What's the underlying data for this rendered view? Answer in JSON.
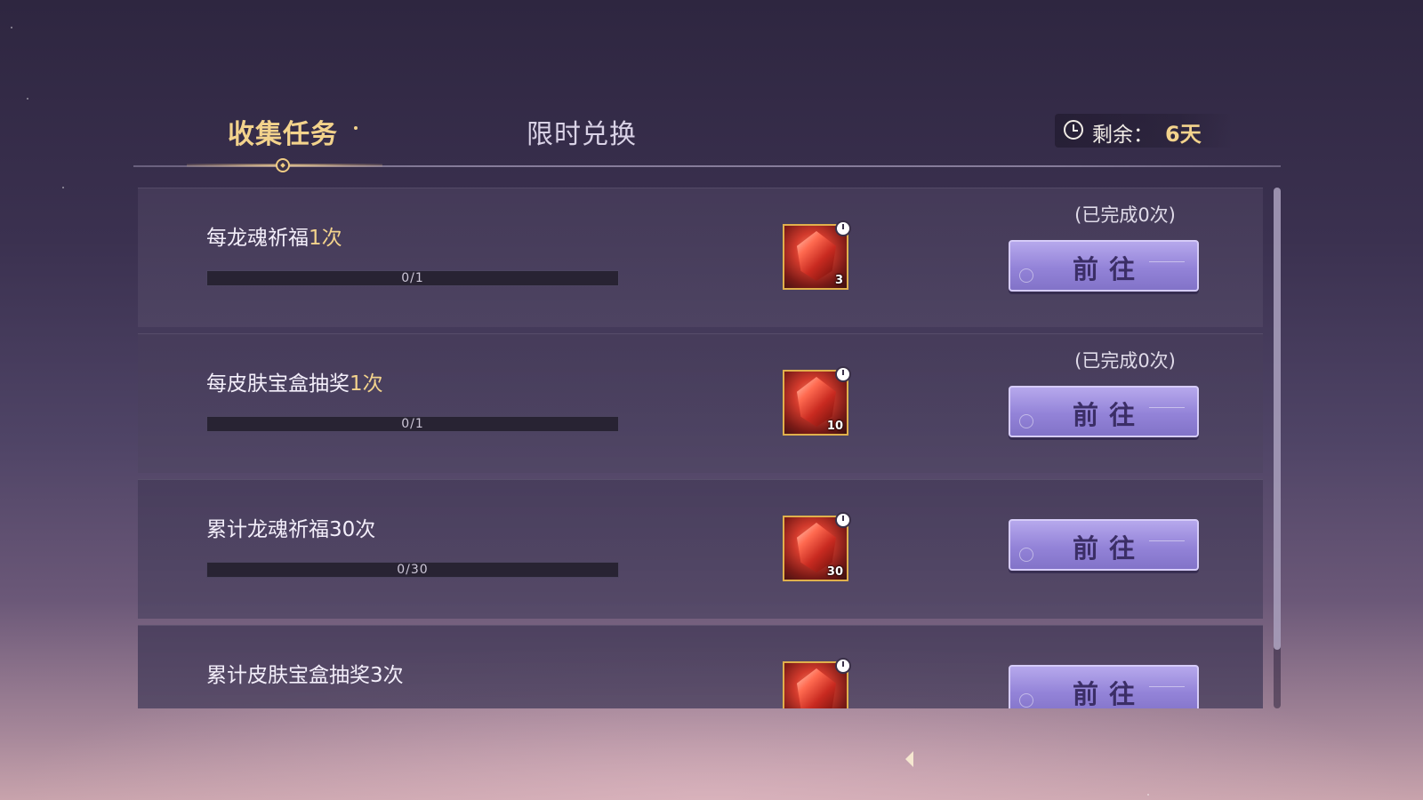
{
  "tabs": [
    {
      "label": "收集任务",
      "active": true
    },
    {
      "label": "限时兑换",
      "active": false
    }
  ],
  "timer": {
    "label": "剩余：",
    "value": "6天",
    "icon": "clock-icon"
  },
  "tasks": [
    {
      "title_main": "每龙魂祈福",
      "title_highlight": "1次",
      "progress_text": "0/1",
      "progress": 0,
      "reward_icon": "red-crystal-icon",
      "reward_count": "3",
      "completed_text": "(已完成0次)",
      "button_label": "前往"
    },
    {
      "title_main": "每皮肤宝盒抽奖",
      "title_highlight": "1次",
      "progress_text": "0/1",
      "progress": 0,
      "reward_icon": "red-crystal-icon",
      "reward_count": "10",
      "completed_text": "(已完成0次)",
      "button_label": "前往"
    },
    {
      "title_main": "累计龙魂祈福30次",
      "title_highlight": "",
      "progress_text": "0/30",
      "progress": 0,
      "reward_icon": "red-crystal-icon",
      "reward_count": "30",
      "completed_text": "",
      "button_label": "前往"
    },
    {
      "title_main": "累计皮肤宝盒抽奖3次",
      "title_highlight": "",
      "progress_text": "",
      "progress": 0,
      "reward_icon": "red-crystal-icon",
      "reward_count": "",
      "completed_text": "",
      "button_label": "前往"
    }
  ],
  "colors": {
    "accent_gold": "#f3d38c",
    "button": "#9383d8",
    "button_text": "#3b2e66"
  }
}
